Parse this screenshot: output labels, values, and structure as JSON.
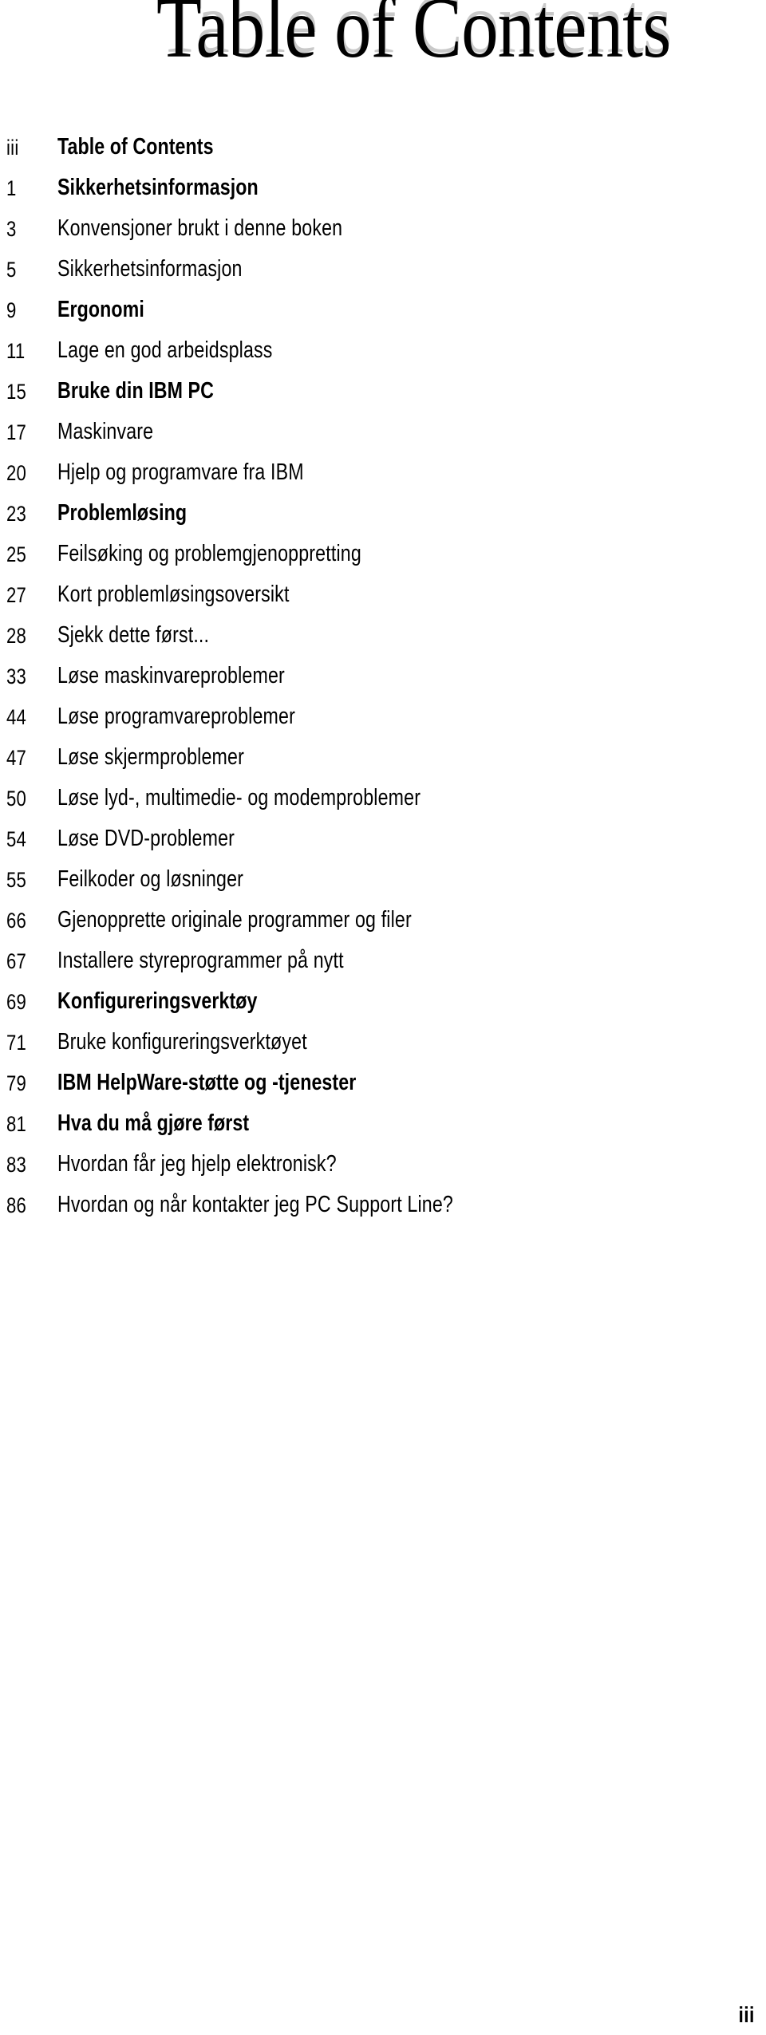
{
  "title": {
    "text": "Table of Contents"
  },
  "footer": {
    "folio": "iii"
  },
  "toc": {
    "entries": [
      {
        "page": "iii",
        "label": "Table of Contents",
        "bold": true
      },
      {
        "page": "1",
        "label": "Sikkerhetsinformasjon",
        "bold": true
      },
      {
        "page": "3",
        "label": "Konvensjoner brukt i denne boken",
        "bold": false
      },
      {
        "page": "5",
        "label": "Sikkerhetsinformasjon",
        "bold": false
      },
      {
        "page": "9",
        "label": "Ergonomi",
        "bold": true
      },
      {
        "page": "11",
        "label": "Lage en god arbeidsplass",
        "bold": false
      },
      {
        "page": "15",
        "label": "Bruke din IBM PC",
        "bold": true
      },
      {
        "page": "17",
        "label": "Maskinvare",
        "bold": false
      },
      {
        "page": "20",
        "label": "Hjelp og programvare fra IBM",
        "bold": false
      },
      {
        "page": "23",
        "label": "Problemløsing",
        "bold": true
      },
      {
        "page": "25",
        "label": "Feilsøking og problemgjenoppretting",
        "bold": false
      },
      {
        "page": "27",
        "label": "Kort problemløsingsoversikt",
        "bold": false
      },
      {
        "page": "28",
        "label": "Sjekk dette først...",
        "bold": false
      },
      {
        "page": "33",
        "label": "Løse maskinvareproblemer",
        "bold": false
      },
      {
        "page": "44",
        "label": "Løse programvareproblemer",
        "bold": false
      },
      {
        "page": "47",
        "label": "Løse skjermproblemer",
        "bold": false
      },
      {
        "page": "50",
        "label": "Løse lyd-, multimedie- og modemproblemer",
        "bold": false
      },
      {
        "page": "54",
        "label": "Løse DVD-problemer",
        "bold": false
      },
      {
        "page": "55",
        "label": "Feilkoder og løsninger",
        "bold": false
      },
      {
        "page": "66",
        "label": "Gjenopprette originale programmer og filer",
        "bold": false
      },
      {
        "page": "67",
        "label": "Installere styreprogrammer på nytt",
        "bold": false
      },
      {
        "page": "69",
        "label": "Konfigureringsverktøy",
        "bold": true
      },
      {
        "page": "71",
        "label": "Bruke konfigureringsverktøyet",
        "bold": false
      },
      {
        "page": "79",
        "label": "IBM HelpWare-støtte og -tjenester",
        "bold": true
      },
      {
        "page": "81",
        "label": "Hva du må gjøre først",
        "bold": true
      },
      {
        "page": "83",
        "label": "Hvordan får jeg hjelp elektronisk?",
        "bold": false
      },
      {
        "page": "86",
        "label": "Hvordan og når kontakter jeg PC Support Line?",
        "bold": false
      }
    ]
  }
}
